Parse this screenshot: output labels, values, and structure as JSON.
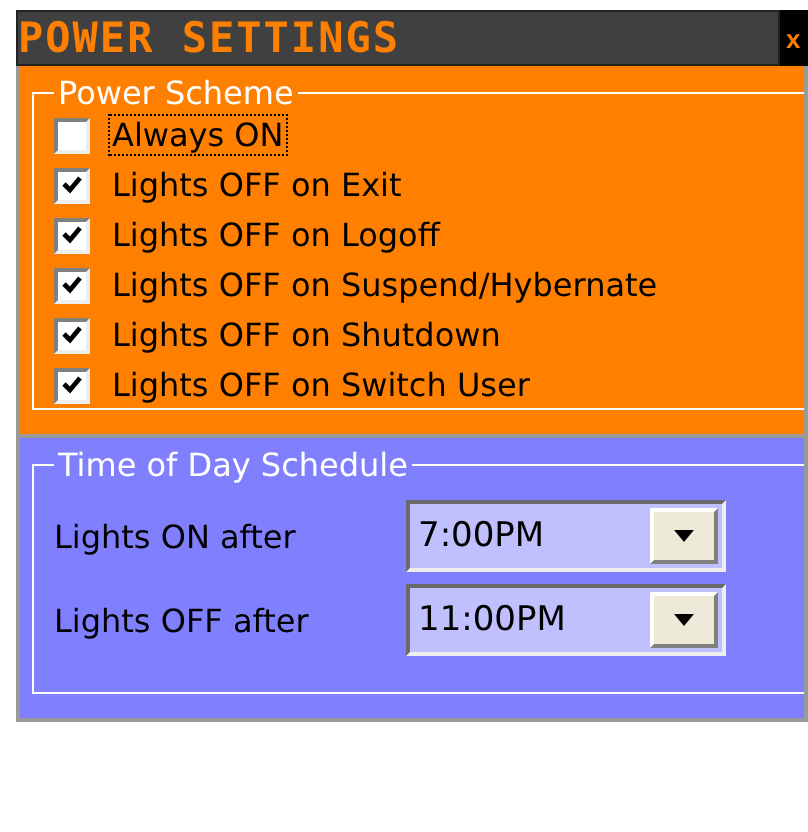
{
  "window": {
    "title": "POWER SETTINGS",
    "close": "x"
  },
  "power_scheme": {
    "legend": "Power Scheme",
    "options": [
      {
        "label": "Always ON",
        "checked": false,
        "focused": true
      },
      {
        "label": "Lights OFF on Exit",
        "checked": true,
        "focused": false
      },
      {
        "label": "Lights OFF on Logoff",
        "checked": true,
        "focused": false
      },
      {
        "label": "Lights OFF on Suspend/Hybernate",
        "checked": true,
        "focused": false
      },
      {
        "label": "Lights OFF on Shutdown",
        "checked": true,
        "focused": false
      },
      {
        "label": "Lights OFF on Switch User",
        "checked": true,
        "focused": false
      }
    ]
  },
  "schedule": {
    "legend": "Time of Day Schedule",
    "rows": [
      {
        "label": "Lights ON after",
        "value": "7:00PM"
      },
      {
        "label": "Lights OFF after",
        "value": "11:00PM"
      }
    ]
  }
}
